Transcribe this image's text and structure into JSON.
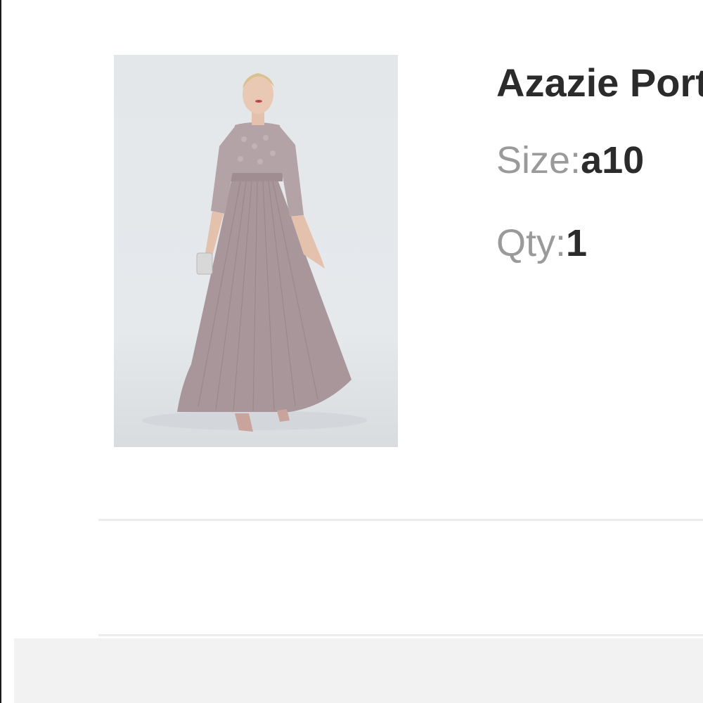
{
  "product": {
    "title": "Azazie Portia",
    "image_alt": "Model wearing a long dusty mauve pleated chiffon dress with lace three-quarter sleeves",
    "size": {
      "label": "Size:",
      "value": "a10"
    },
    "qty": {
      "label": "Qty:",
      "value": "1"
    }
  },
  "colors": {
    "dress": "#a8969b",
    "background": "#e4e7ea",
    "text_dark": "#2b2b2b",
    "text_label": "#9a9a9a",
    "footer": "#f2f2f2"
  }
}
